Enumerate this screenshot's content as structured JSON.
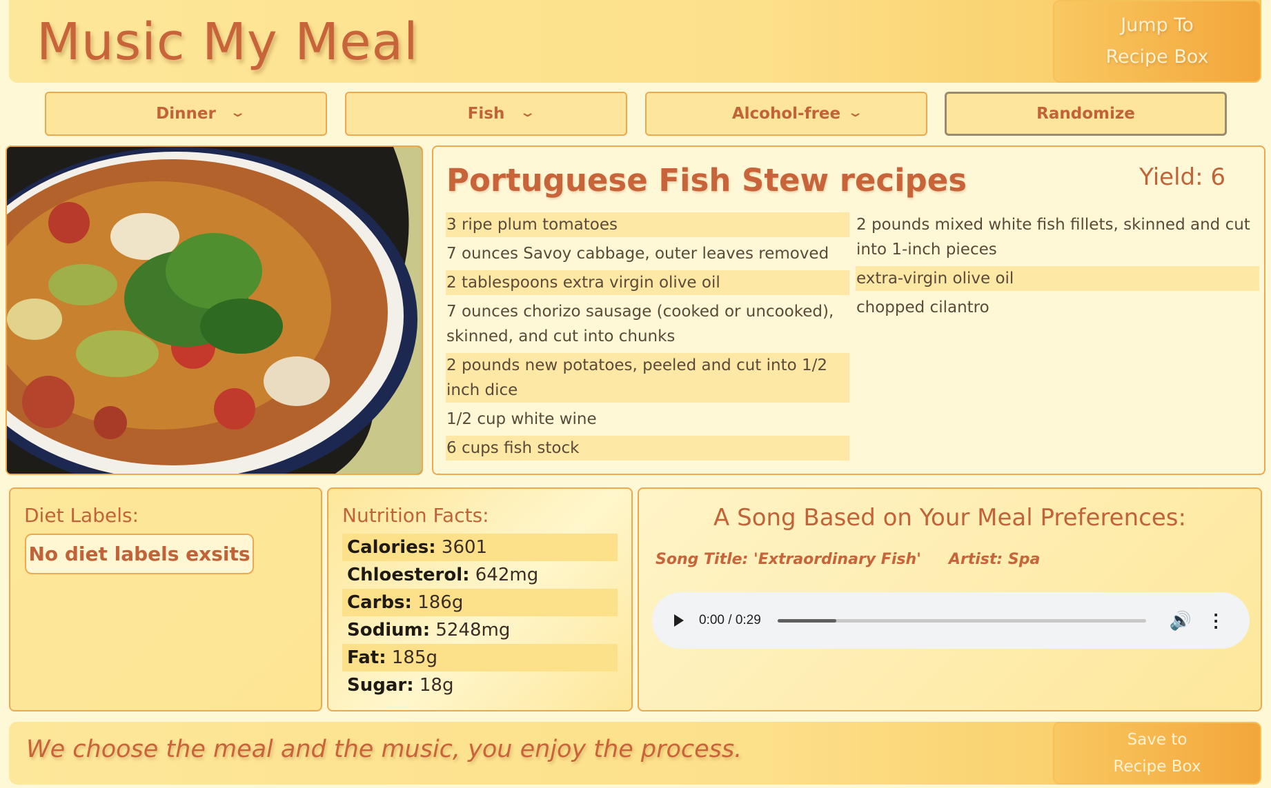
{
  "header": {
    "title": "Music My Meal",
    "jump_button": [
      "Jump To",
      "Recipe Box"
    ]
  },
  "filters": [
    {
      "value": "Dinner"
    },
    {
      "value": "Fish"
    },
    {
      "value": "Alcohol-free"
    }
  ],
  "randomize_label": "Randomize",
  "recipe": {
    "title": "Portuguese Fish Stew recipes",
    "yield": "Yield: 6",
    "ingredients_left": [
      "3 ripe plum tomatoes",
      "7 ounces Savoy cabbage, outer leaves removed",
      "2 tablespoons extra virgin olive oil",
      "7 ounces chorizo sausage (cooked or uncooked), skinned, and cut into chunks",
      "2 pounds new potatoes, peeled and cut into 1/2 inch dice",
      "1/2 cup white wine",
      "6 cups fish stock"
    ],
    "ingredients_right": [
      "2 pounds mixed white fish fillets, skinned and cut into 1-inch pieces",
      "extra-virgin olive oil",
      "chopped cilantro"
    ]
  },
  "diet": {
    "label": "Diet Labels:",
    "badge": "No diet labels exsits"
  },
  "nutrition": {
    "label": "Nutrition Facts:",
    "rows": [
      {
        "name": "Calories:",
        "value": "3601"
      },
      {
        "name": "Chloesterol:",
        "value": "642mg"
      },
      {
        "name": "Carbs:",
        "value": "186g"
      },
      {
        "name": "Sodium:",
        "value": "5248mg"
      },
      {
        "name": "Fat:",
        "value": "185g"
      },
      {
        "name": "Sugar:",
        "value": "18g"
      }
    ]
  },
  "song": {
    "heading": "A Song Based on Your Meal Preferences:",
    "title": "Song Title: 'Extraordinary Fish'",
    "artist": "Artist: Spa",
    "time": "0:00 / 0:29",
    "progress": 0.16
  },
  "footer": {
    "tagline": "We choose the meal and the music, you enjoy the process.",
    "save_button": [
      "Save to",
      "Recipe Box"
    ]
  },
  "icons": {
    "chevron": "chevron-down-icon",
    "play": "play-icon",
    "volume": "volume-icon",
    "more": "more-vert-icon"
  }
}
